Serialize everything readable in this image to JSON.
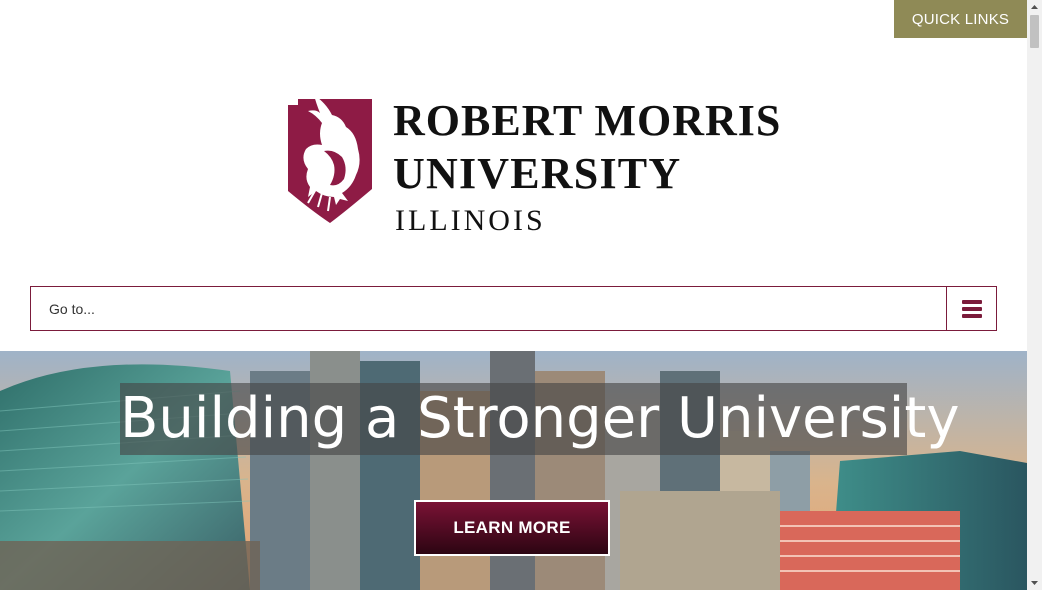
{
  "header": {
    "quick_links_label": "QUICK LINKS"
  },
  "logo": {
    "line1": "ROBERT MORRIS",
    "line2": "UNIVERSITY",
    "line3": "ILLINOIS"
  },
  "nav": {
    "goto_label": "Go to...",
    "menu_icon": "hamburger-menu-icon"
  },
  "hero": {
    "headline": "Building a Stronger University",
    "button_label": "LEARN MORE"
  },
  "colors": {
    "brand_maroon": "#7b1b3b",
    "quick_links_bg": "#8f8a56"
  }
}
